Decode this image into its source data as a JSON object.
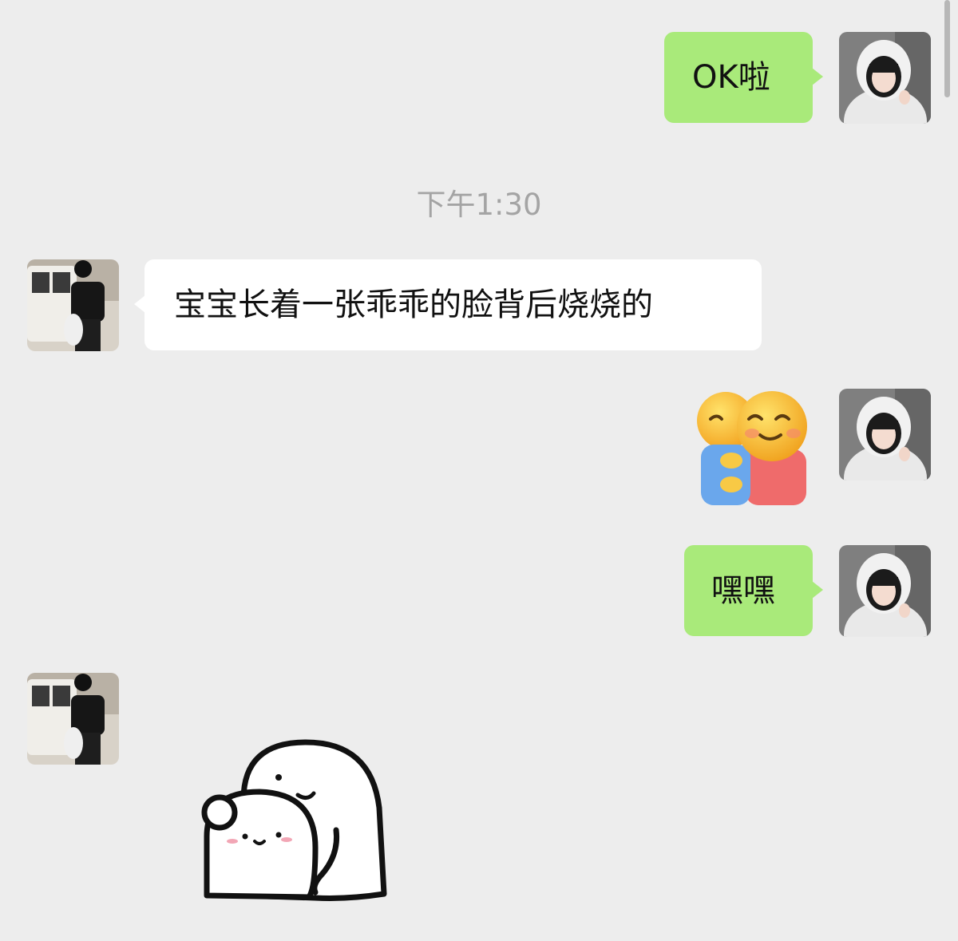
{
  "timestamp": "下午1:30",
  "messages": [
    {
      "sender": "me",
      "type": "text",
      "text": "OK啦"
    },
    {
      "sender": "other",
      "type": "text",
      "text": "宝宝长着一张乖乖的脸背后烧烧的"
    },
    {
      "sender": "me",
      "type": "emoji",
      "icon": "hug-emoji-icon"
    },
    {
      "sender": "me",
      "type": "text",
      "text": "嘿嘿"
    },
    {
      "sender": "other",
      "type": "sticker",
      "icon": "ghost-hug-sticker-icon"
    }
  ],
  "colors": {
    "background": "#ededed",
    "my_bubble": "#a9ea7a",
    "their_bubble": "#ffffff",
    "timestamp": "#a4a4a4"
  }
}
